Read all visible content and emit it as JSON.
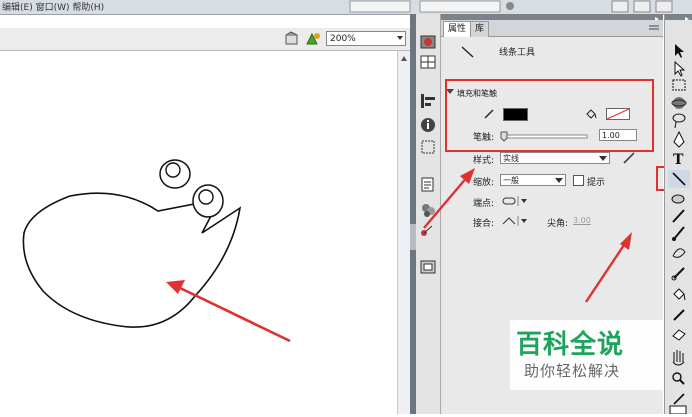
{
  "menu": {
    "partial": "编辑(E)   窗口(W)   帮助(H)"
  },
  "stage_toolbar": {
    "zoom": "200%"
  },
  "properties_panel": {
    "tab_properties": "属性",
    "tab_library": "库",
    "tool_name": "线条工具",
    "section_title": "填充和笔触",
    "stroke_color": "#000000",
    "stroke_label": "笔触:",
    "stroke_value": "1.00",
    "style_label": "样式:",
    "style_value": "实线",
    "scale_label": "缩放:",
    "scale_value": "一般",
    "hint_label": "提示",
    "cap_label": "端点:",
    "join_label": "接合:",
    "miter_label": "尖角:",
    "miter_value": "3.00"
  },
  "watermark": {
    "title": "百科全说",
    "subtitle": "助你轻松解决"
  },
  "highlight_color": "#e03030"
}
